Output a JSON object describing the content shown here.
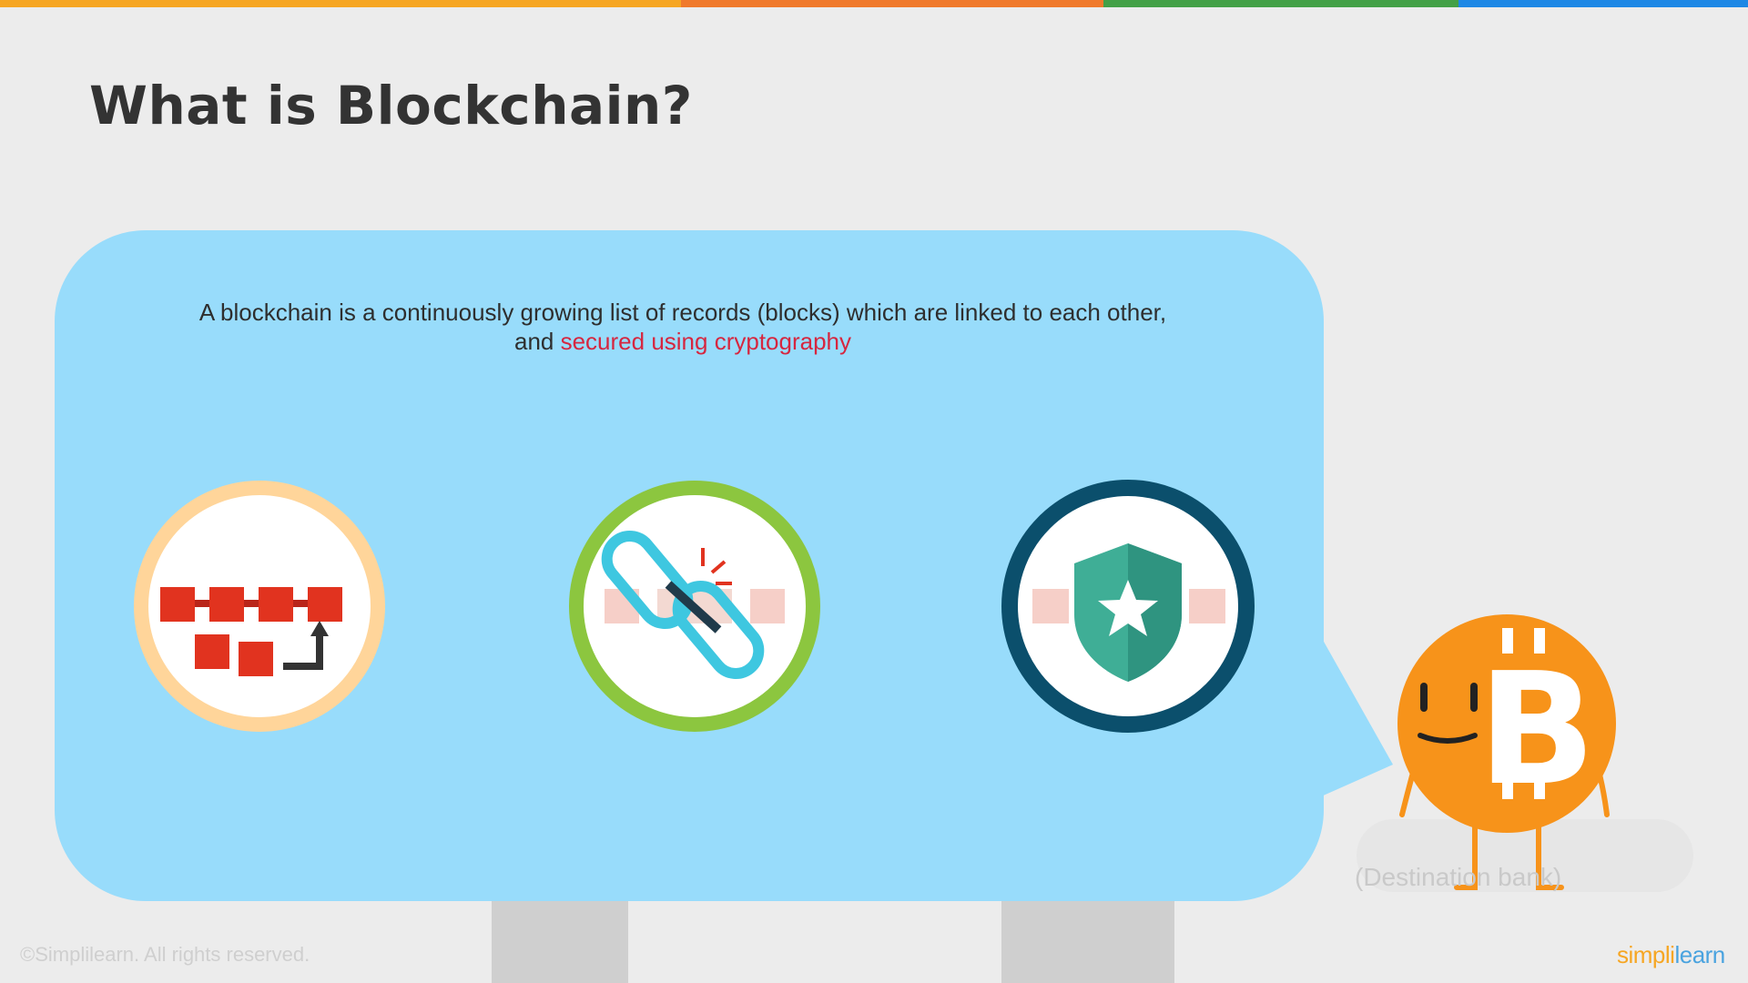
{
  "top_bar_colors": [
    "#f6a623",
    "#f07a2c",
    "#43a047",
    "#1e88e5"
  ],
  "slide": {
    "title": "What is Blockchain?",
    "definition_part1": "A blockchain is a continuously growing list of records (blocks) which are linked to each other,",
    "definition_part2_prefix": "and ",
    "definition_highlight": "secured using cryptography",
    "highlight_color": "#d6263f",
    "bubble_color": "#98dcfb"
  },
  "icons": [
    {
      "name": "block-chain-icon",
      "ring_color": "#ffd59a"
    },
    {
      "name": "chain-link-icon",
      "ring_color": "#8cc63f"
    },
    {
      "name": "shield-star-icon",
      "ring_color": "#0b4f6c"
    }
  ],
  "mascot": {
    "name": "bitcoin-mascot-icon",
    "color": "#f7931a"
  },
  "background_label": "(Destination bank)",
  "footer": {
    "copyright": "©Simplilearn. All rights reserved.",
    "brand_part1": "simpli",
    "brand_part2": "learn"
  }
}
